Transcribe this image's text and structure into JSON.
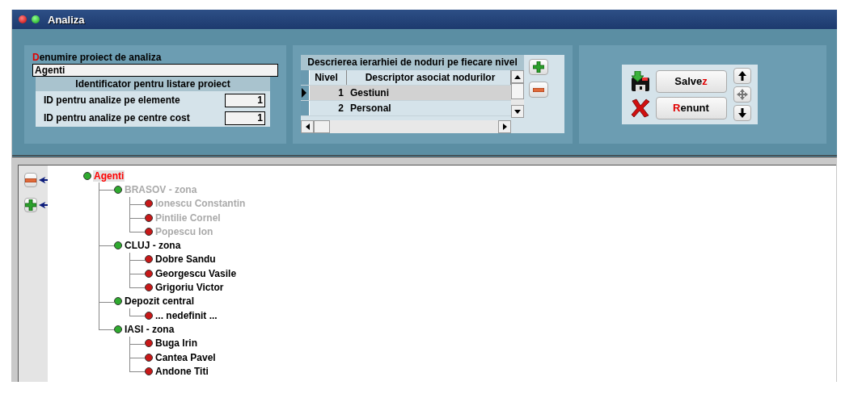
{
  "window": {
    "title": "Analiza"
  },
  "project": {
    "name_label": [
      {
        "text": "D",
        "accel": true
      },
      {
        "text": "enumire proiect de analiza",
        "accel": false
      }
    ],
    "name_value": "Agenti",
    "id_section_title": "Identificator pentru listare proiect",
    "id_fields": [
      {
        "label": "ID pentru analize pe elemente",
        "value": "1"
      },
      {
        "label": "ID pentru analize pe centre cost",
        "value": "1"
      }
    ]
  },
  "levels": {
    "title": "Descrierea ierarhiei de noduri pe fiecare nivel",
    "columns": [
      "Nivel",
      "Descriptor asociat nodurilor"
    ],
    "rows": [
      {
        "nivel": "1",
        "descriptor": "Gestiuni",
        "selected": true
      },
      {
        "nivel": "2",
        "descriptor": "Personal",
        "selected": false
      }
    ]
  },
  "actions": {
    "buttons": [
      {
        "kind": "save",
        "label": [
          {
            "text": "Salve",
            "accel": false
          },
          {
            "text": "z",
            "accel": true
          }
        ]
      },
      {
        "kind": "cancel",
        "label": [
          {
            "text": "R",
            "accel": true
          },
          {
            "text": "enunt",
            "accel": false
          }
        ]
      }
    ]
  },
  "tree": {
    "root": {
      "label": "Agenti",
      "color": "#2faa2f",
      "selected": true,
      "disabled": false,
      "children": [
        {
          "label": "BRASOV - zona",
          "color": "#2faa2f",
          "selected": false,
          "disabled": true,
          "children": [
            {
              "label": "Ionescu Constantin",
              "color": "#c81818",
              "selected": false,
              "disabled": true
            },
            {
              "label": "Pintilie Cornel",
              "color": "#c81818",
              "selected": false,
              "disabled": true
            },
            {
              "label": "Popescu Ion",
              "color": "#c81818",
              "selected": false,
              "disabled": true
            }
          ]
        },
        {
          "label": "CLUJ - zona",
          "color": "#2faa2f",
          "selected": false,
          "disabled": false,
          "children": [
            {
              "label": "Dobre Sandu",
              "color": "#c81818",
              "selected": false,
              "disabled": false
            },
            {
              "label": "Georgescu Vasile",
              "color": "#c81818",
              "selected": false,
              "disabled": false
            },
            {
              "label": "Grigoriu Victor",
              "color": "#c81818",
              "selected": false,
              "disabled": false
            }
          ]
        },
        {
          "label": "Depozit central",
          "color": "#2faa2f",
          "selected": false,
          "disabled": false,
          "children": [
            {
              "label": "... nedefinit ...",
              "color": "#c81818",
              "selected": false,
              "disabled": false
            }
          ]
        },
        {
          "label": "IASI - zona",
          "color": "#2faa2f",
          "selected": false,
          "disabled": false,
          "children": [
            {
              "label": "Buga Irin",
              "color": "#c81818",
              "selected": false,
              "disabled": false
            },
            {
              "label": "Cantea Pavel",
              "color": "#c81818",
              "selected": false,
              "disabled": false
            },
            {
              "label": "Andone Titi",
              "color": "#c81818",
              "selected": false,
              "disabled": false
            }
          ]
        }
      ]
    }
  }
}
